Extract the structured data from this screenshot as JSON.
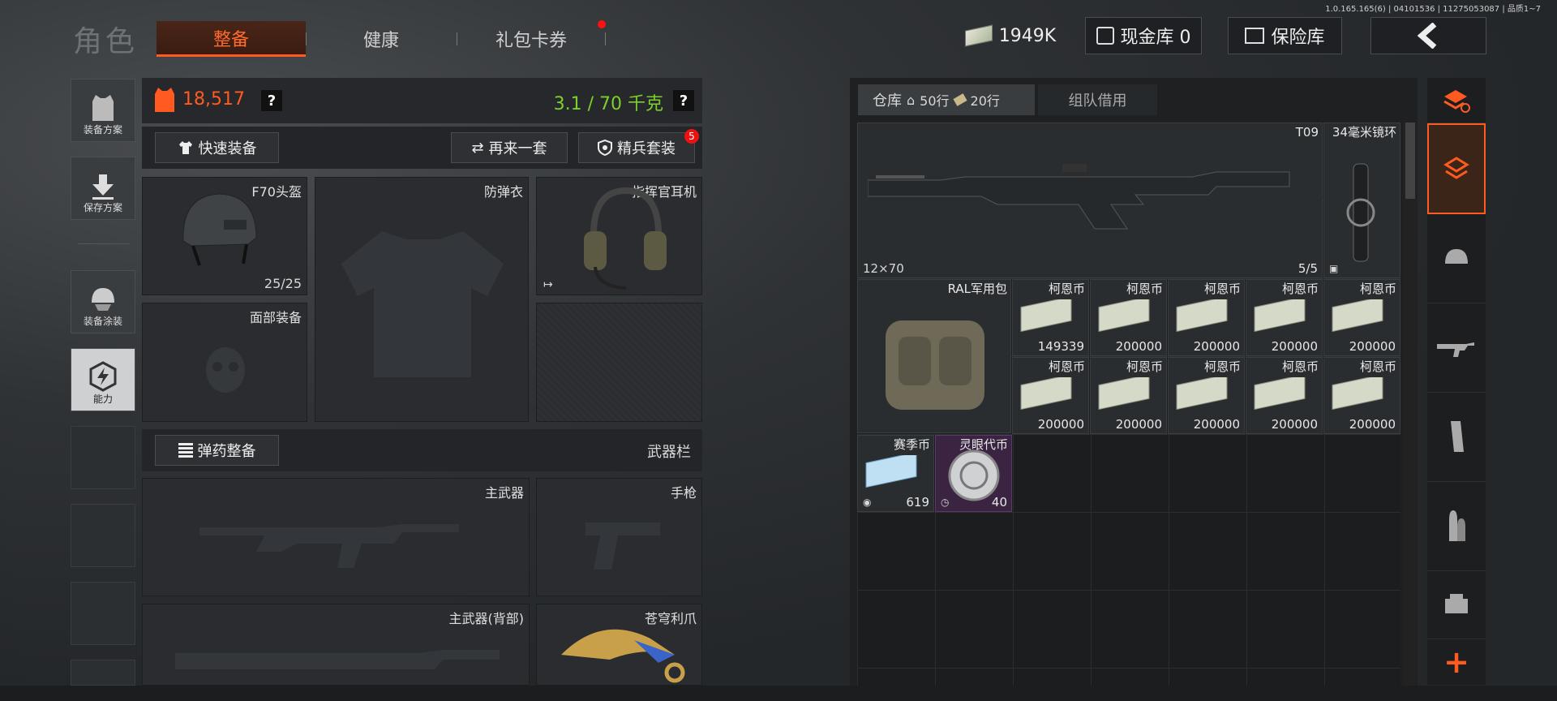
{
  "header": {
    "title": "角色",
    "tabs": [
      {
        "label": "整备",
        "active": true
      },
      {
        "label": "健康"
      },
      {
        "label": "礼包卡券"
      }
    ],
    "build_info": "1.0.165.165(6) | 04101536 | 11275053087 | 品质1~7",
    "currency": "1949K",
    "cash_vault": "现金库 0",
    "safe": "保险库"
  },
  "left_nav": [
    {
      "label": "装备方案"
    },
    {
      "label": "保存方案"
    },
    {
      "label": "装备涂装"
    },
    {
      "label": "能力"
    }
  ],
  "loadout": {
    "value": "18,517",
    "weight": "3.1 / 70 千克",
    "help": "?",
    "quick_equip": "快速装备",
    "again": "再来一套",
    "elite": "精兵套装",
    "elite_badge": "5",
    "slots": {
      "helmet": "F70头盔",
      "helmet_dur": "25/25",
      "armor": "防弹衣",
      "headset": "指挥官耳机",
      "face": "面部装备"
    },
    "ammo_btn": "弹药整备",
    "weapons_label": "武器栏",
    "primary": "主武器",
    "pistol": "手枪",
    "primary_back": "主武器(背部)",
    "melee": "苍穹利爪"
  },
  "inventory": {
    "tab_label": "仓库",
    "rows1": "50行",
    "rows2": "20行",
    "team_tab": "组队借用",
    "gun": {
      "name": "T09",
      "ammo": "12×70",
      "count": "5/5"
    },
    "scope": {
      "name": "34毫米镜环"
    },
    "backpack": {
      "name": "RAL军用包"
    },
    "money_label": "柯恩币",
    "money": [
      "149339",
      "200000",
      "200000",
      "200000",
      "200000",
      "200000",
      "200000",
      "200000",
      "200000",
      "200000"
    ],
    "season": {
      "name": "赛季币",
      "count": "619"
    },
    "token": {
      "name": "灵眼代币",
      "count": "40"
    }
  },
  "colors": {
    "accent": "#ff5a1f",
    "weight": "#7bd12a"
  }
}
